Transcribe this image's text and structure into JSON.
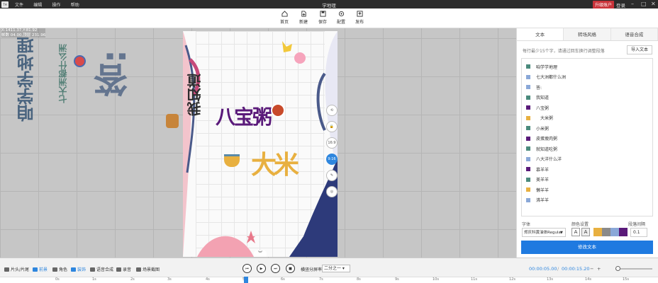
{
  "titlebar": {
    "logo": "TH",
    "menu": [
      "文件",
      "编辑",
      "操作",
      "帮助"
    ],
    "title": "学地理",
    "vip": "升级账户",
    "login": "登录"
  },
  "toolbar": {
    "buttons": [
      {
        "label": "首页",
        "icon": "home-icon"
      },
      {
        "label": "新建",
        "icon": "new-file-icon"
      },
      {
        "label": "保存",
        "icon": "save-icon"
      },
      {
        "label": "配置",
        "icon": "settings-icon"
      },
      {
        "label": "发布",
        "icon": "publish-icon"
      }
    ]
  },
  "canvas": {
    "coords": [
      "X:1411.37,Y:81.92",
      "帧数 04.00,顶层 231.96"
    ],
    "ghost_texts": [
      "咱学学地理",
      "七大洲都什么洲",
      "答:"
    ],
    "stage_texts": {
      "vertical": "我知道",
      "line1": "八宝粥",
      "line2": "大米"
    },
    "side_tools": [
      "⟲",
      "🔒",
      "16:9",
      "9:16",
      "✎",
      "◎"
    ]
  },
  "panel": {
    "tabs": [
      "文本",
      "转场风格",
      "语音合成"
    ],
    "hint": "每行最少15个字，请通过回车换行调整段落",
    "import": "导入文本",
    "items": [
      {
        "text": "咱学学地理",
        "color": "#4a8a7c"
      },
      {
        "text": "七大洲都什么洲",
        "color": "#8aa8d8"
      },
      {
        "text": "答:",
        "color": "#8aa8d8"
      },
      {
        "text": "我知道",
        "color": "#4a8a7c"
      },
      {
        "text": "八宝粥",
        "color": "#5a1a7a"
      },
      {
        "text": "大米粥",
        "color": "#e8b040"
      },
      {
        "text": "小米粥",
        "color": "#4a8a7c"
      },
      {
        "text": "皮蛋瘦肉粥",
        "color": "#5a1a7a"
      },
      {
        "text": "就知道吃粥",
        "color": "#4a8a7c"
      },
      {
        "text": "八大洋什么洋",
        "color": "#8aa8d8"
      },
      {
        "text": "慕羊羊",
        "color": "#5a1a7a"
      },
      {
        "text": "美羊羊",
        "color": "#4a8a7c"
      },
      {
        "text": "懒羊羊",
        "color": "#e8b040"
      },
      {
        "text": "沸羊羊",
        "color": "#8aa8d8"
      }
    ],
    "font_label": "字体",
    "color_label": "颜色设置",
    "spacing_label": "段落间隔",
    "font_value": "郑庆科黄油体Regular",
    "colors": [
      "#e8b040",
      "#8a8a8a",
      "#8aa8d8",
      "#5a1a7a"
    ],
    "spacing_value": "0.1",
    "modify": "修改文本"
  },
  "bottom": {
    "items": [
      "片头/片尾",
      "前景",
      "角色",
      "装饰",
      "语音合成",
      "录音",
      "场景截图"
    ],
    "split_label": "横竖分屏率",
    "split_value": "二分之一",
    "time_current": "00:00:05.00",
    "time_total": "00:00:15.20",
    "ticks": [
      "0s",
      "1s",
      "2s",
      "3s",
      "4s",
      "5s",
      "6s",
      "7s",
      "8s",
      "9s",
      "10s",
      "11s",
      "12s",
      "13s",
      "14s",
      "15s"
    ]
  }
}
